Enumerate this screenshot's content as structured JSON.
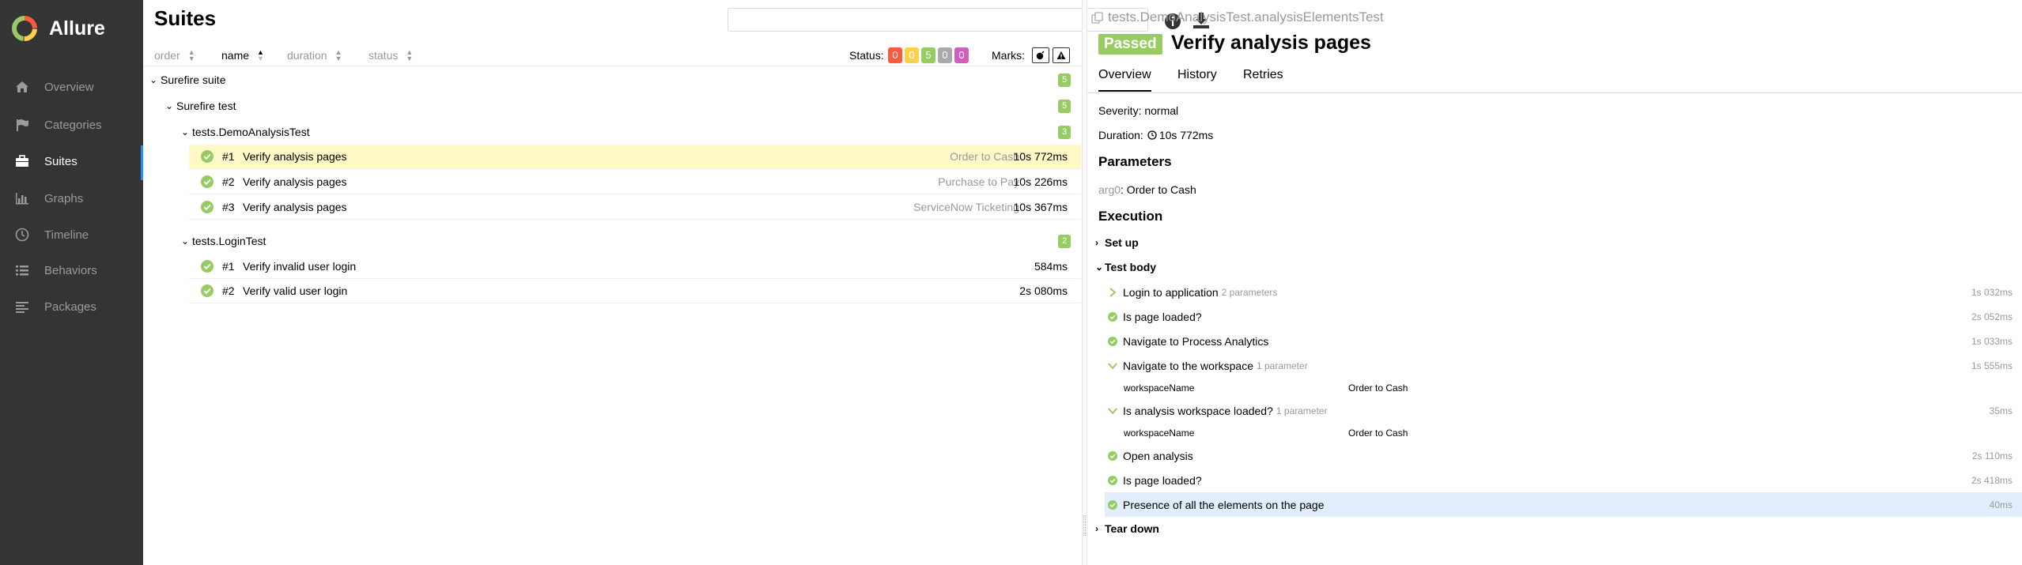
{
  "sidebar": {
    "brand": "Allure",
    "items": [
      {
        "label": "Overview",
        "icon": "home-icon"
      },
      {
        "label": "Categories",
        "icon": "flag-icon"
      },
      {
        "label": "Suites",
        "icon": "briefcase-icon",
        "active": true
      },
      {
        "label": "Graphs",
        "icon": "bar-chart-icon"
      },
      {
        "label": "Timeline",
        "icon": "clock-icon"
      },
      {
        "label": "Behaviors",
        "icon": "list-icon"
      },
      {
        "label": "Packages",
        "icon": "align-left-icon"
      }
    ]
  },
  "left": {
    "title": "Suites",
    "search": {
      "value": "",
      "placeholder": ""
    },
    "sorters": [
      "order",
      "name",
      "duration",
      "status"
    ],
    "status_label": "Status:",
    "status_counts": [
      {
        "value": "0",
        "color": "#fd5a3e"
      },
      {
        "value": "0",
        "color": "#ffd050"
      },
      {
        "value": "5",
        "color": "#97cc64"
      },
      {
        "value": "0",
        "color": "#aaaaaa"
      },
      {
        "value": "0",
        "color": "#d35ebe"
      }
    ],
    "marks_label": "Marks:",
    "tree": {
      "root": {
        "label": "Surefire suite",
        "count": "5"
      },
      "child": {
        "label": "Surefire test",
        "count": "5"
      },
      "groups": [
        {
          "label": "tests.DemoAnalysisTest",
          "count": "3",
          "tests": [
            {
              "num": "#1",
              "name": "Verify analysis pages",
              "param": "Order to Cash",
              "duration": "10s 772ms"
            },
            {
              "num": "#2",
              "name": "Verify analysis pages",
              "param": "Purchase to Pay",
              "duration": "10s 226ms"
            },
            {
              "num": "#3",
              "name": "Verify analysis pages",
              "param": "ServiceNow Ticketing",
              "duration": "10s 367ms"
            }
          ]
        },
        {
          "label": "tests.LoginTest",
          "count": "2",
          "tests": [
            {
              "num": "#1",
              "name": "Verify invalid user login",
              "param": "",
              "duration": "584ms"
            },
            {
              "num": "#2",
              "name": "Verify valid user login",
              "param": "",
              "duration": "2s 080ms"
            }
          ]
        }
      ]
    }
  },
  "right": {
    "breadcrumb": "tests.DemoAnalysisTest.analysisElementsTest",
    "status": "Passed",
    "title": "Verify analysis pages",
    "tabs": [
      "Overview",
      "History",
      "Retries"
    ],
    "severity": "Severity: normal",
    "duration_label": "Duration:",
    "duration_value": "10s 772ms",
    "parameters_heading": "Parameters",
    "param_name": "arg0",
    "param_value": ": Order to Cash",
    "execution_heading": "Execution",
    "setup": "Set up",
    "test_body": "Test body",
    "steps": [
      {
        "name": "Login to application",
        "sub": "2 parameters",
        "duration": "1s 032ms",
        "icon": "chevron-right"
      },
      {
        "name": "Is page loaded?",
        "sub": "",
        "duration": "2s 052ms",
        "icon": "passed"
      },
      {
        "name": "Navigate to Process Analytics",
        "sub": "",
        "duration": "1s 033ms",
        "icon": "passed"
      },
      {
        "name": "Navigate to the workspace",
        "sub": "1 parameter",
        "duration": "1s 555ms",
        "icon": "chevron-down"
      },
      {
        "name": "Is analysis workspace loaded?",
        "sub": "1 parameter",
        "duration": "35ms",
        "icon": "chevron-down"
      },
      {
        "name": "Open analysis",
        "sub": "",
        "duration": "2s 110ms",
        "icon": "passed"
      },
      {
        "name": "Is page loaded?",
        "sub": "",
        "duration": "2s 418ms",
        "icon": "passed"
      },
      {
        "name": "Presence of all the elements on the page",
        "sub": "",
        "duration": "40ms",
        "icon": "passed"
      }
    ],
    "step_params": [
      {
        "name": "workspaceName",
        "value": "Order to Cash"
      },
      {
        "name": "workspaceName",
        "value": "Order to Cash"
      }
    ],
    "teardown": "Tear down"
  }
}
